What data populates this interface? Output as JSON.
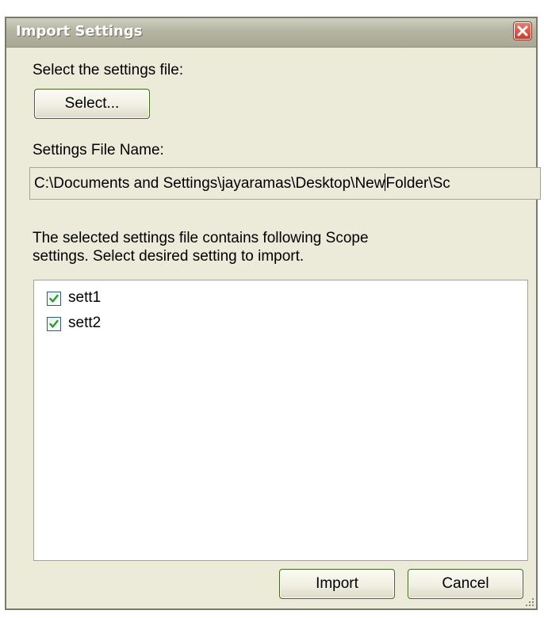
{
  "window": {
    "title": "Import Settings"
  },
  "select_section": {
    "prompt": "Select the settings file:",
    "select_button": "Select..."
  },
  "file_section": {
    "label": "Settings File Name:",
    "path_before_caret": "C:\\Documents and Settings\\jayaramas\\Desktop\\New",
    "path_after_caret": "Folder\\Sc"
  },
  "settings_section": {
    "description_line1": "The selected settings file contains following Scope",
    "description_line2": "settings. Select desired setting to import.",
    "items": [
      {
        "label": "sett1",
        "checked": true
      },
      {
        "label": "sett2",
        "checked": true
      }
    ]
  },
  "footer": {
    "import_button": "Import",
    "cancel_button": "Cancel"
  },
  "icons": {
    "close": "close-icon",
    "check": "checkmark-icon",
    "grip": "resize-grip-icon"
  },
  "colors": {
    "titlebar": "#b4b4a2",
    "window_bg": "#ecead8",
    "close_red": "#cf3a2a",
    "button_border": "#3f6b1e",
    "check_green": "#21a121"
  }
}
